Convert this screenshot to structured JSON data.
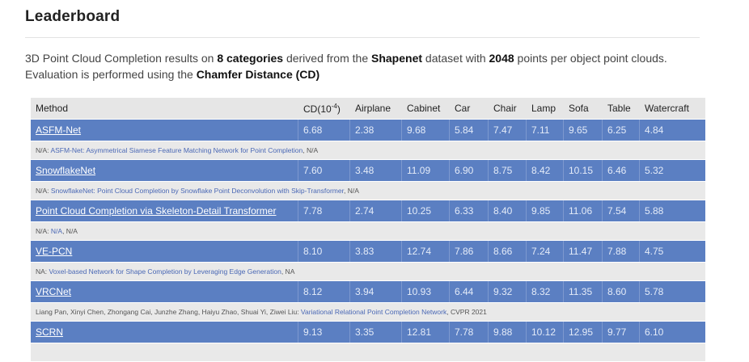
{
  "heading": "Leaderboard",
  "intro": {
    "p1": "3D Point Cloud Completion results on ",
    "b1": "8 categories",
    "p2": " derived from the ",
    "b2": "Shapenet",
    "p3": " dataset with ",
    "b3": "2048",
    "p4": " points per object point clouds. Evaluation is performed using the ",
    "b4": "Chamfer Distance (CD)"
  },
  "columns": {
    "method": "Method",
    "cd_base": "CD(10",
    "cd_exp": "-4",
    "cd_close": ")",
    "airplane": "Airplane",
    "cabinet": "Cabinet",
    "car": "Car",
    "chair": "Chair",
    "lamp": "Lamp",
    "sofa": "Sofa",
    "table": "Table",
    "watercraft": "Watercraft"
  },
  "rows": [
    {
      "method": "ASFM-Net",
      "values": [
        "6.68",
        "2.38",
        "9.68",
        "5.84",
        "7.47",
        "7.11",
        "9.65",
        "6.25",
        "4.84"
      ],
      "desc_prefix": "N/A: ",
      "desc_link": "ASFM-Net: Asymmetrical Siamese Feature Matching Network for Point Completion",
      "desc_suffix": ", N/A"
    },
    {
      "method": "SnowflakeNet",
      "values": [
        "7.60",
        "3.48",
        "11.09",
        "6.90",
        "8.75",
        "8.42",
        "10.15",
        "6.46",
        "5.32"
      ],
      "desc_prefix": "N/A: ",
      "desc_link": "SnowflakeNet: Point Cloud Completion by Snowflake Point Deconvolution with Skip-Transformer",
      "desc_suffix": ", N/A"
    },
    {
      "method": "Point Cloud Completion via Skeleton-Detail Transformer",
      "values": [
        "7.78",
        "2.74",
        "10.25",
        "6.33",
        "8.40",
        "9.85",
        "11.06",
        "7.54",
        "5.88"
      ],
      "desc_prefix": "N/A: ",
      "desc_link": "N/A",
      "desc_suffix": ", N/A"
    },
    {
      "method": "VE-PCN",
      "values": [
        "8.10",
        "3.83",
        "12.74",
        "7.86",
        "8.66",
        "7.24",
        "11.47",
        "7.88",
        "4.75"
      ],
      "desc_prefix": "NA: ",
      "desc_link": "Voxel-based Network for Shape Completion by Leveraging Edge Generation",
      "desc_suffix": ", NA"
    },
    {
      "method": "VRCNet",
      "values": [
        "8.12",
        "3.94",
        "10.93",
        "6.44",
        "9.32",
        "8.32",
        "11.35",
        "8.60",
        "5.78"
      ],
      "desc_prefix": "Liang Pan, Xinyi Chen, Zhongang Cai, Junzhe Zhang, Haiyu Zhao, Shuai Yi, Ziwei Liu: ",
      "desc_link": "Variational Relational Point Completion Network",
      "desc_suffix": ", CVPR 2021"
    },
    {
      "method": "SCRN",
      "values": [
        "9.13",
        "3.35",
        "12.81",
        "7.78",
        "9.88",
        "10.12",
        "12.95",
        "9.77",
        "6.10"
      ],
      "desc_prefix": "",
      "desc_link": "",
      "desc_suffix": ""
    }
  ]
}
